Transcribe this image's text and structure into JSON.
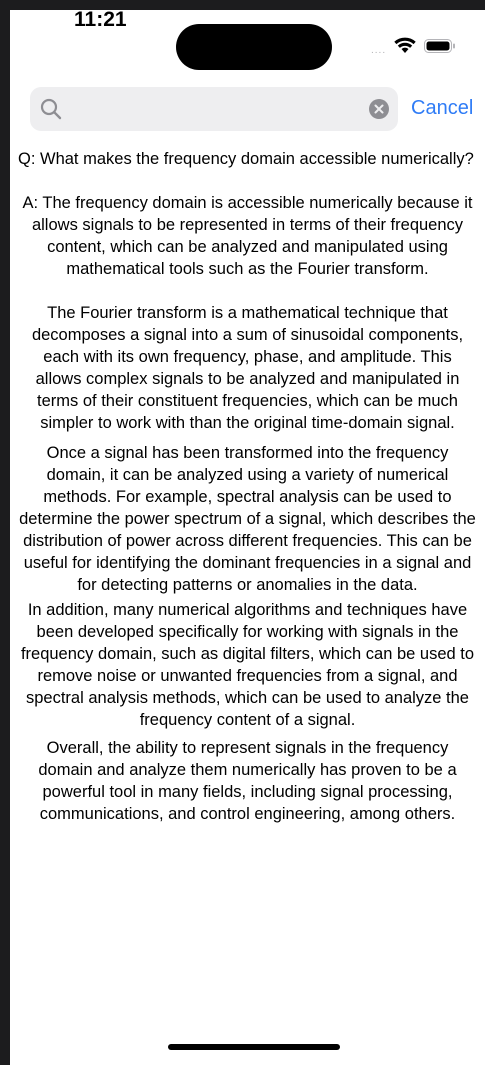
{
  "status_bar": {
    "time": "11:21",
    "signal": "....",
    "wifi_icon": "wifi-icon",
    "battery_icon": "battery-icon"
  },
  "search": {
    "value": "",
    "placeholder": "",
    "cancel_label": "Cancel",
    "search_icon": "search-icon",
    "clear_icon": "clear-icon"
  },
  "content": {
    "question": "Q: What makes the frequency domain accessible numerically?",
    "paragraphs": [
      {
        "lines": [
          "A: The frequency domain is accessible numerically because it",
          "allows signals to be represented in terms of their frequency",
          "content, which can be analyzed and manipulated using",
          "mathematical tools such as the Fourier transform."
        ]
      },
      {
        "lines": [
          "The Fourier transform is a mathematical technique that",
          "decomposes a signal into a sum of sinusoidal components,",
          "each with its own frequency, phase, and amplitude. This",
          "allows complex signals to be analyzed and manipulated in",
          "terms of their constituent frequencies, which can be much",
          "simpler to work with than the original time-domain signal."
        ]
      },
      {
        "lines": [
          "Once a signal has been transformed into the frequency",
          "domain, it can be analyzed using a variety of numerical",
          "methods. For example, spectral analysis can be used to",
          "determine the power spectrum of a signal, which describes the",
          "distribution of power across different frequencies. This can be",
          "useful for identifying the dominant frequencies in a signal and",
          "for detecting patterns or anomalies in the data."
        ]
      },
      {
        "lines": [
          "In addition, many numerical algorithms and techniques have",
          "been developed specifically for working with signals in the",
          "frequency domain, such as digital filters, which can be used to",
          "remove noise or unwanted frequencies from a signal, and",
          "spectral analysis methods, which can be used to analyze the",
          "frequency content of a signal."
        ]
      },
      {
        "lines": [
          "Overall, the ability to represent signals in the frequency",
          "domain and analyze them numerically has proven to be a",
          "powerful tool in many fields, including signal processing,",
          "communications, and control engineering, among others."
        ]
      }
    ]
  },
  "colors": {
    "accent": "#2f7cf6",
    "search_background": "#eeeef0",
    "frame": "#1c1c1e"
  }
}
